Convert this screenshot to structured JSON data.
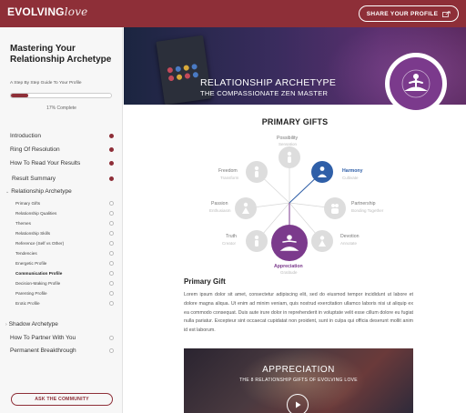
{
  "brand": {
    "logo_text": "EVOLVING",
    "logo_script": "love"
  },
  "header": {
    "share_label": "SHARE YOUR PROFILE",
    "accent": "#8e2f38"
  },
  "sidebar": {
    "title": "Mastering Your Relationship Archetype",
    "subtitle": "A Step By Step Guide To Your Profile",
    "progress_value": 0.17,
    "progress_text": "17% Complete",
    "items": [
      {
        "label": "Introduction",
        "done": true
      },
      {
        "label": "Ring Of Resolution",
        "done": true
      },
      {
        "label": "How To Read Your Results",
        "done": true
      },
      {
        "label": "Result Summary",
        "done": true
      },
      {
        "label": "Relationship Archetype",
        "expanded": true
      },
      {
        "label": "Primary Gifts"
      },
      {
        "label": "Relationship Qualities"
      },
      {
        "label": "Themes"
      },
      {
        "label": "Relationship Skills"
      },
      {
        "label": "Reference (Self vs Other)"
      },
      {
        "label": "Tendencies"
      },
      {
        "label": "Energetic Profile"
      },
      {
        "label": "Communication Profile",
        "active": true
      },
      {
        "label": "Decision-Making Profile"
      },
      {
        "label": "Parenting Profile"
      },
      {
        "label": "Erotic Profile"
      },
      {
        "label": "Shadow Archetype",
        "collapsed": true
      },
      {
        "label": "How To Partner With You"
      },
      {
        "label": "Permanent Breakthrough"
      }
    ],
    "community_label": "ASK THE COMMUNITY"
  },
  "hero": {
    "title": "RELATIONSHIP ARCHETYPE",
    "subtitle": "THE COMPASSIONATE ZEN MASTER",
    "badge_icon": "meditating-figure-icon"
  },
  "gifts": {
    "heading": "PRIMARY GIFTS",
    "nodes": [
      {
        "title": "Possibility",
        "sub": "Sensation"
      },
      {
        "title": "Harmony",
        "sub": "Cultivate"
      },
      {
        "title": "Partnership",
        "sub": "Bonding Together"
      },
      {
        "title": "Devotion",
        "sub": "Annotate"
      },
      {
        "title": "Appreciation",
        "sub": "Gratitude"
      },
      {
        "title": "Truth",
        "sub": "Creator"
      },
      {
        "title": "Passion",
        "sub": "Enthusiasm"
      },
      {
        "title": "Freedom",
        "sub": "Transform"
      }
    ],
    "blue": "#2f5fa8",
    "purple": "#7b3a8c"
  },
  "primary_gift": {
    "heading": "Primary Gift",
    "body": "Lorem ipsum dolor sit amet, consectetur adipiscing elit, sed do eiusmod tempor incididunt ut labore et dolore magna aliqua. Ut enim ad minim veniam, quis nostrud exercitation ullamco laboris nisi ut aliquip ex ea commodo consequat. Duis aute irure dolor in reprehenderit in voluptate velit esse cillum dolore eu fugiat nulla pariatur. Excepteur sint occaecat cupidatat non proident, sunt in culpa qui officia deserunt mollit anim id est laborum."
  },
  "video": {
    "title": "APPRECIATION",
    "subtitle": "THE 8 RELATIONSHIP GIFTS OF EVOLVING LOVE",
    "play_icon": "play-icon"
  }
}
